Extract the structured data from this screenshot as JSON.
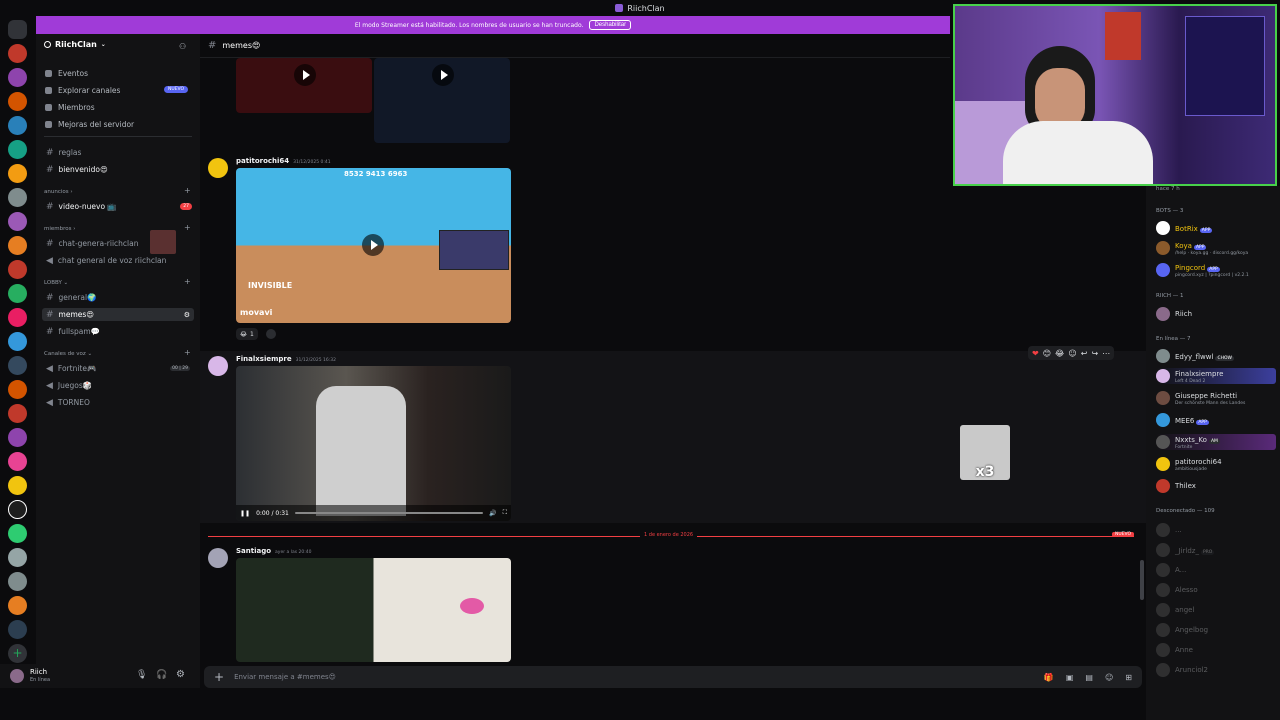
{
  "window": {
    "title": "RiichClan"
  },
  "banner": {
    "text": "El modo Streamer está habilitado. Los nombres de usuario se han truncado.",
    "button": "Deshabilitar"
  },
  "server": {
    "name": "RiichClan"
  },
  "nav": [
    {
      "label": "Eventos"
    },
    {
      "label": "Explorar canales",
      "badge": "NUEVO"
    },
    {
      "label": "Miembros"
    },
    {
      "label": "Mejoras del servidor"
    }
  ],
  "channels": {
    "reglas": "reglas",
    "bienvenido": "bienvenido😍",
    "cat_anuncios": "anuncios",
    "video_nuevo": "video-nuevo 📺",
    "video_nuevo_badge": "27",
    "cat_miembros": "miembros",
    "chat_genera": "chat-genera-riichclan",
    "chat_voz": "chat general de voz riichclan",
    "cat_lobby": "LOBBY",
    "general": "general🌍",
    "memes": "memes😍",
    "fullspam": "fullspam💬",
    "cat_voz": "Canales de voz",
    "fortnite": "Fortnite🎮",
    "fortnite_count_a": "00",
    "fortnite_count_b": "29",
    "juegos": "Juegos🎲",
    "torneo": "TORNEO"
  },
  "user": {
    "name": "Riich",
    "status": "En línea"
  },
  "chat": {
    "channel": "memes😍",
    "messages": [
      {
        "author": "patitorochi64",
        "time": "31/12/2025 0:41",
        "overlay_text": "8532 9413 6963",
        "watermark": "movavi",
        "video_label": "INVISIBLE",
        "reaction_count": "1"
      },
      {
        "author": "Finalxsiempre",
        "time": "31/12/2025 16:32",
        "player_time": "0:00 / 0:31",
        "sticker_label": "x3"
      },
      {
        "author": "Santiago",
        "time": "ayer a las 20:40"
      }
    ],
    "divider": "1 de enero de 2026",
    "divider_badge": "NUEVO"
  },
  "composer": {
    "placeholder": "Enviar mensaje a #memes😍"
  },
  "members": {
    "top_status": "hace 7 h",
    "bots_header": "BOTS — 3",
    "bots": [
      {
        "name": "BotRix",
        "tag": "APP",
        "sub": ""
      },
      {
        "name": "Koya",
        "tag": "APP",
        "sub": "/help · koya.gg · discord.gg/koya"
      },
      {
        "name": "Pingcord",
        "tag": "APP",
        "sub": "pingcord.xyz | ?pingcord | v2.2.1"
      }
    ],
    "riich_header": "RIICH — 1",
    "riich": [
      {
        "name": "Riich"
      }
    ],
    "online_header": "En línea — 7",
    "online": [
      {
        "name": "Edyy_flwwl",
        "tag": "CHOW",
        "sub": ""
      },
      {
        "name": "Finalxsiempre",
        "sub": "Left 4 Dead 2"
      },
      {
        "name": "Giuseppe Richetti",
        "sub": "Der schönste Mann des Landes"
      },
      {
        "name": "MEE6",
        "tag": "APP",
        "sub": ""
      },
      {
        "name": "Nxxts_Ko",
        "tag": "AM",
        "sub": "Fortnite"
      },
      {
        "name": "patitorochi64",
        "sub": "ambitiousjade"
      },
      {
        "name": "Thilex",
        "sub": ""
      }
    ],
    "offline_header": "Desconectado — 109",
    "offline": [
      {
        "name": "..."
      },
      {
        "name": "_Jirldz_",
        "tag": "PRO"
      },
      {
        "name": "A..."
      },
      {
        "name": "Alesso"
      },
      {
        "name": "angel"
      },
      {
        "name": "Angelbog"
      },
      {
        "name": "Anne"
      },
      {
        "name": "Arunciol2"
      }
    ]
  },
  "colors": {
    "accent": "#5865f2",
    "banner": "#a03bd8",
    "webcam_border": "#48d14b",
    "unread": "#f23f43"
  }
}
